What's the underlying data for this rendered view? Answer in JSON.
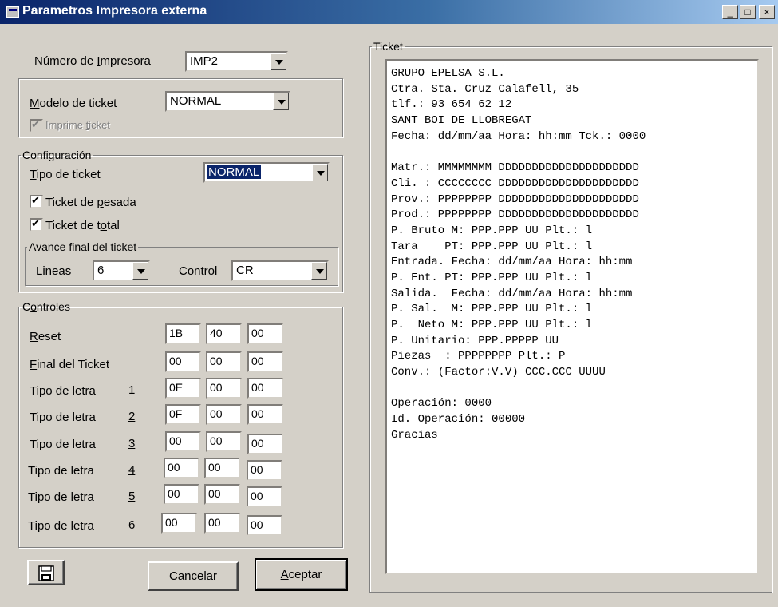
{
  "window": {
    "title": "Parametros Impresora externa",
    "minimize_glyph": "_",
    "maximize_glyph": "□",
    "close_glyph": "×"
  },
  "printer": {
    "label": "Número de Impresora",
    "label_underlined": "I",
    "value": "IMP2"
  },
  "model": {
    "label": "Modelo de ticket",
    "value": "NORMAL",
    "print_ticket_label": "Imprime ticket",
    "print_ticket_checked": true,
    "print_ticket_enabled": false
  },
  "config": {
    "legend": "Configuración",
    "ticket_type_label": "Tipo de ticket",
    "ticket_type_value": "NORMAL",
    "weighing_ticket_label": "Ticket de pesada",
    "weighing_ticket_checked": true,
    "total_ticket_label": "Ticket de total",
    "total_ticket_checked": true,
    "advance": {
      "legend": "Avance final del ticket",
      "lines_label": "Lineas",
      "lines_value": "6",
      "control_label": "Control",
      "control_value": "CR"
    }
  },
  "controls": {
    "legend": "Controles",
    "rows": [
      {
        "label": "Reset",
        "number": "",
        "values": [
          "1B",
          "40",
          "00"
        ]
      },
      {
        "label": "Final del Ticket",
        "number": "",
        "values": [
          "00",
          "00",
          "00"
        ]
      },
      {
        "label": "Tipo de letra",
        "number": "1",
        "values": [
          "0E",
          "00",
          "00"
        ]
      },
      {
        "label": "Tipo de letra",
        "number": "2",
        "values": [
          "0F",
          "00",
          "00"
        ]
      },
      {
        "label": "Tipo de letra",
        "number": "3",
        "values": [
          "00",
          "00",
          "00"
        ]
      },
      {
        "label": "Tipo de letra",
        "number": "4",
        "values": [
          "00",
          "00",
          "00"
        ]
      },
      {
        "label": "Tipo de letra",
        "number": "5",
        "values": [
          "00",
          "00",
          "00"
        ]
      },
      {
        "label": "Tipo de letra",
        "number": "6",
        "values": [
          "00",
          "00",
          "00"
        ]
      }
    ]
  },
  "buttons": {
    "save_icon": "floppy-disk-icon",
    "cancel_label": "Cancelar",
    "accept_label": "Aceptar"
  },
  "ticket": {
    "legend": "Ticket",
    "lines": [
      "GRUPO EPELSA S.L.",
      "Ctra. Sta. Cruz Calafell, 35",
      "tlf.: 93 654 62 12",
      "SANT BOI DE LLOBREGAT",
      "Fecha: dd/mm/aa Hora: hh:mm Tck.: 0000",
      "",
      "Matr.: MMMMMMMM DDDDDDDDDDDDDDDDDDDDD",
      "Cli. : CCCCCCCC DDDDDDDDDDDDDDDDDDDDD",
      "Prov.: PPPPPPPP DDDDDDDDDDDDDDDDDDDDD",
      "Prod.: PPPPPPPP DDDDDDDDDDDDDDDDDDDDD",
      "P. Bruto M: PPP.PPP UU Plt.: l",
      "Tara    PT: PPP.PPP UU Plt.: l",
      "Entrada. Fecha: dd/mm/aa Hora: hh:mm",
      "P. Ent. PT: PPP.PPP UU Plt.: l",
      "Salida.  Fecha: dd/mm/aa Hora: hh:mm",
      "P. Sal.  M: PPP.PPP UU Plt.: l",
      "P.  Neto M: PPP.PPP UU Plt.: l",
      "P. Unitario: PPP.PPPPP UU",
      "Piezas  : PPPPPPPP Plt.: P",
      "Conv.: (Factor:V.V) CCC.CCC UUUU",
      "",
      "Operación: 0000",
      "Id. Operación: 00000",
      "Gracias"
    ]
  }
}
